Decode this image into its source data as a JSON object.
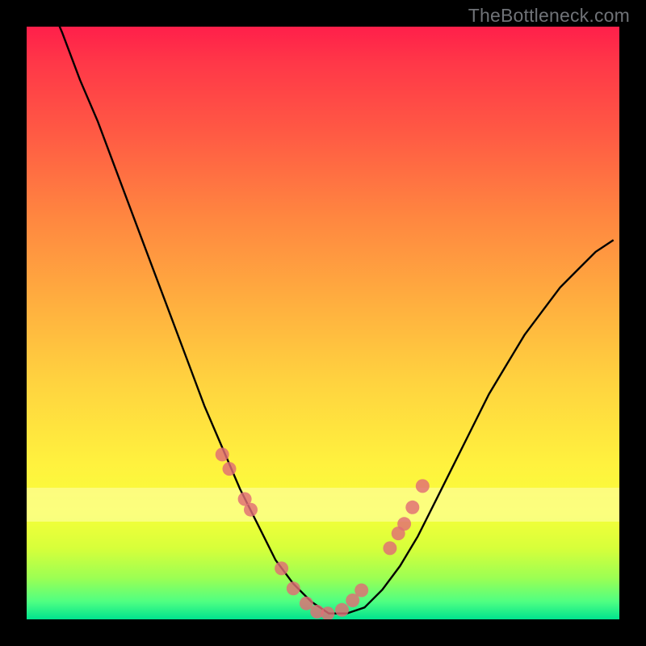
{
  "watermark": "TheBottleneck.com",
  "colors": {
    "frame": "#000000",
    "curve_stroke": "#000000",
    "point_fill": "#e06c75",
    "point_stroke": "#c45561",
    "gradient_top": "#ff1f4a",
    "gradient_bottom": "#00e38e",
    "band": "#ffffb4"
  },
  "chart_data": {
    "type": "line",
    "title": "",
    "xlabel": "",
    "ylabel": "",
    "xlim": [
      0,
      100
    ],
    "ylim": [
      0,
      100
    ],
    "x_comment": "percent of horizontal axis (0 left, 100 right) inside the plot area",
    "y_comment": "percent of vertical axis (0 bottom, 100 top) inside the plot area",
    "series": [
      {
        "name": "curve",
        "x": [
          0,
          3,
          6,
          9,
          12,
          15,
          18,
          21,
          24,
          27,
          30,
          33,
          36,
          39,
          42,
          45,
          48,
          51,
          54,
          57,
          60,
          63,
          66,
          69,
          72,
          75,
          78,
          81,
          84,
          87,
          90,
          93,
          96,
          99
        ],
        "y": [
          112,
          106,
          99,
          91,
          84,
          76,
          68,
          60,
          52,
          44,
          36,
          29,
          22,
          16,
          10,
          6,
          3,
          1,
          1,
          2,
          5,
          9,
          14,
          20,
          26,
          32,
          38,
          43,
          48,
          52,
          56,
          59,
          62,
          64
        ]
      }
    ],
    "scatter_points": {
      "name": "markers",
      "x": [
        33.0,
        34.2,
        36.8,
        37.8,
        43.0,
        45.0,
        47.2,
        49.0,
        50.8,
        53.2,
        55.0,
        56.5,
        61.3,
        62.7,
        63.7,
        65.1,
        66.8
      ],
      "y": [
        27.8,
        25.4,
        20.3,
        18.5,
        8.6,
        5.2,
        2.7,
        1.3,
        1.0,
        1.6,
        3.2,
        4.9,
        12.0,
        14.5,
        16.1,
        18.9,
        22.5
      ]
    }
  }
}
